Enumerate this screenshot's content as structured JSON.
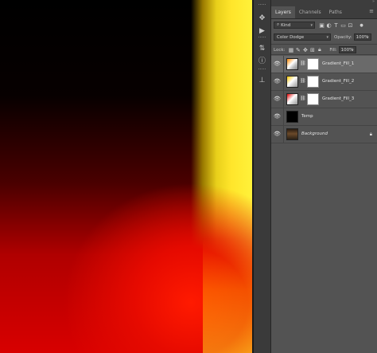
{
  "panel": {
    "tabs": [
      "Layers",
      "Channels",
      "Paths"
    ],
    "active_tab": "Layers",
    "filter": {
      "label": "Kind"
    },
    "blend_mode": "Color Dodge",
    "opacity": {
      "label": "Opacity:",
      "value": "100%"
    },
    "lock": {
      "label": "Lock:"
    },
    "fill": {
      "label": "Fill:",
      "value": "100%"
    }
  },
  "layers": [
    {
      "name": "Gradient_Fill_1",
      "visible": true,
      "selected": true,
      "type": "gradient-fill",
      "has_mask": true,
      "swatch": "#ff8a00"
    },
    {
      "name": "Gradient_Fill_2",
      "visible": true,
      "selected": false,
      "type": "gradient-fill",
      "has_mask": true,
      "swatch": "#ffc800"
    },
    {
      "name": "Gradient_Fill_3",
      "visible": true,
      "selected": false,
      "type": "gradient-fill",
      "has_mask": true,
      "swatch": "#e00000"
    },
    {
      "name": "Temp",
      "visible": true,
      "selected": false,
      "type": "pixel",
      "has_mask": false
    },
    {
      "name": "Background",
      "visible": true,
      "selected": false,
      "type": "background",
      "locked": true,
      "italic": true
    }
  ],
  "canvas": {
    "colors": {
      "dark": "#000000",
      "red": "#e60a00",
      "yellow": "#ffe52a"
    }
  },
  "toolstrip": {
    "icons": [
      "move-arrows-icon",
      "play-icon",
      "adjust-icon",
      "info-icon",
      "clone-stamp-icon"
    ]
  }
}
